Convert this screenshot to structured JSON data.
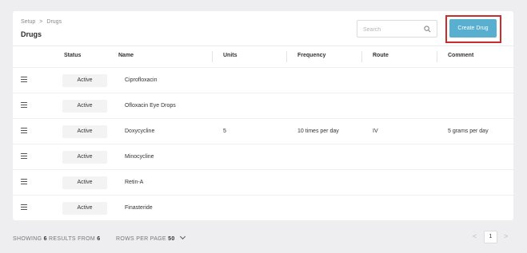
{
  "breadcrumb": {
    "parent": "Setup",
    "separator": ">",
    "current": "Drugs"
  },
  "page_title": "Drugs",
  "search": {
    "placeholder": "Search",
    "value": ""
  },
  "create_button": "Create Drug",
  "columns": {
    "status": "Status",
    "name": "Name",
    "units": "Units",
    "frequency": "Frequency",
    "route": "Route",
    "comment": "Comment"
  },
  "rows": [
    {
      "status": "Active",
      "name": "Ciprofloxacin",
      "units": "",
      "frequency": "",
      "route": "",
      "comment": ""
    },
    {
      "status": "Active",
      "name": "Ofloxacin Eye Drops",
      "units": "",
      "frequency": "",
      "route": "",
      "comment": ""
    },
    {
      "status": "Active",
      "name": "Doxycycline",
      "units": "5",
      "frequency": "10 times per day",
      "route": "IV",
      "comment": "5 grams per day"
    },
    {
      "status": "Active",
      "name": "Minocycline",
      "units": "",
      "frequency": "",
      "route": "",
      "comment": ""
    },
    {
      "status": "Active",
      "name": "Retin-A",
      "units": "",
      "frequency": "",
      "route": "",
      "comment": ""
    },
    {
      "status": "Active",
      "name": "Finasteride",
      "units": "",
      "frequency": "",
      "route": "",
      "comment": ""
    }
  ],
  "footer": {
    "showing_label": "SHOWING",
    "showing_count": "6",
    "results_from_label": "RESULTS FROM",
    "total": "6",
    "rows_per_page_label": "ROWS PER PAGE",
    "rows_per_page": "50"
  },
  "pagination": {
    "prev": "<",
    "current_page": "1",
    "next": ">"
  },
  "colors": {
    "accent": "#58afcf",
    "highlight": "#cc2b2b",
    "background": "#eeeef1"
  }
}
